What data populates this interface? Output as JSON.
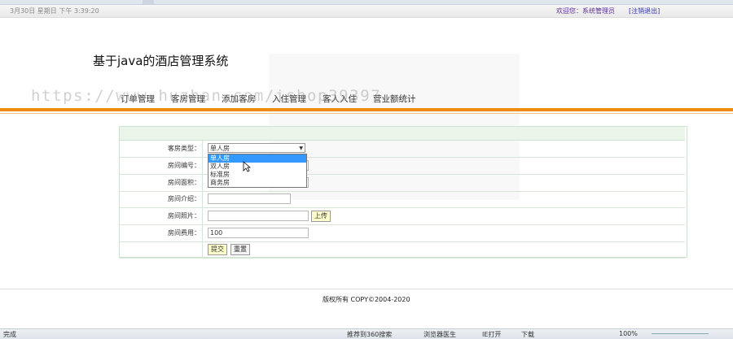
{
  "topbar": {
    "datetime": "3月30日 星期日 下午 3:39:20",
    "welcome": "欢迎您：系统管理员",
    "logout": "[注销退出]"
  },
  "site_title": "基于java的酒店管理系统",
  "watermark": "https://www.huzhan.com/ishop39397",
  "nav": [
    {
      "label": "订单管理"
    },
    {
      "label": "客房管理"
    },
    {
      "label": "添加客房"
    },
    {
      "label": "入住管理"
    },
    {
      "label": "客人入住"
    },
    {
      "label": "营业额统计"
    }
  ],
  "form": {
    "room_type": {
      "label": "客房类型：",
      "value": "单人房"
    },
    "room_no": {
      "label": "房间编号："
    },
    "room_area": {
      "label": "房间面积："
    },
    "room_intro": {
      "label": "房间介绍："
    },
    "room_photo": {
      "label": "房间照片：",
      "upload": "上传"
    },
    "room_price": {
      "label": "房间费用：",
      "value": "100"
    },
    "submit": "提交",
    "reset": "重置"
  },
  "dropdown_options": [
    "单人房",
    "双人房",
    "标准房",
    "商务房"
  ],
  "footer": "版权所有 COPY©2004-2020",
  "statusbar": {
    "done": "完成",
    "recommend": "推荐到360搜索",
    "browser_doctor": "浏览器医生",
    "ie_open": "IE打开",
    "download": "下载",
    "zoom": "100%"
  },
  "colors": {
    "accent": "#ef8a14",
    "header_bg": "#eaf5ea",
    "selected": "#3399ff"
  }
}
